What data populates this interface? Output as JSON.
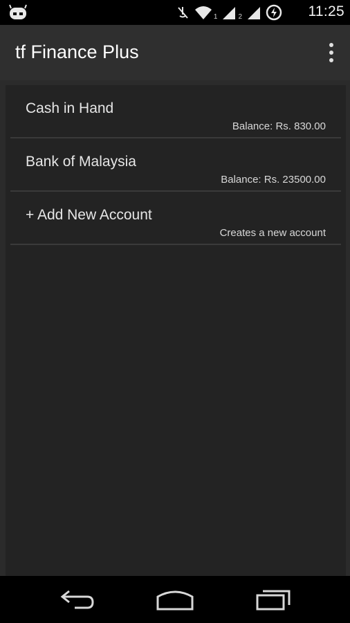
{
  "status_bar": {
    "time": "11:25",
    "signal_sub_1": "1",
    "signal_sub_2": "2",
    "icons": [
      "cyanogen-robot-icon",
      "mute-icon",
      "wifi-icon",
      "signal-icon",
      "signal-icon",
      "data-saver-icon"
    ]
  },
  "action_bar": {
    "title": "tf Finance Plus",
    "overflow_icon": "overflow-menu-icon"
  },
  "accounts": [
    {
      "name": "Cash in Hand",
      "detail": "Balance: Rs. 830.00"
    },
    {
      "name": "Bank of Malaysia",
      "detail": "Balance: Rs. 23500.00"
    },
    {
      "name": "+ Add New Account",
      "detail": "Creates a new account"
    }
  ],
  "nav_bar": {
    "icons": [
      "back-icon",
      "home-icon",
      "recent-apps-icon"
    ]
  },
  "colors": {
    "status_bar": "#000000",
    "action_bar": "#2f2f2f",
    "background": "#2b2b2b",
    "card": "#232323",
    "divider": "#3a3a3a",
    "text_primary": "#e6e6e6"
  }
}
